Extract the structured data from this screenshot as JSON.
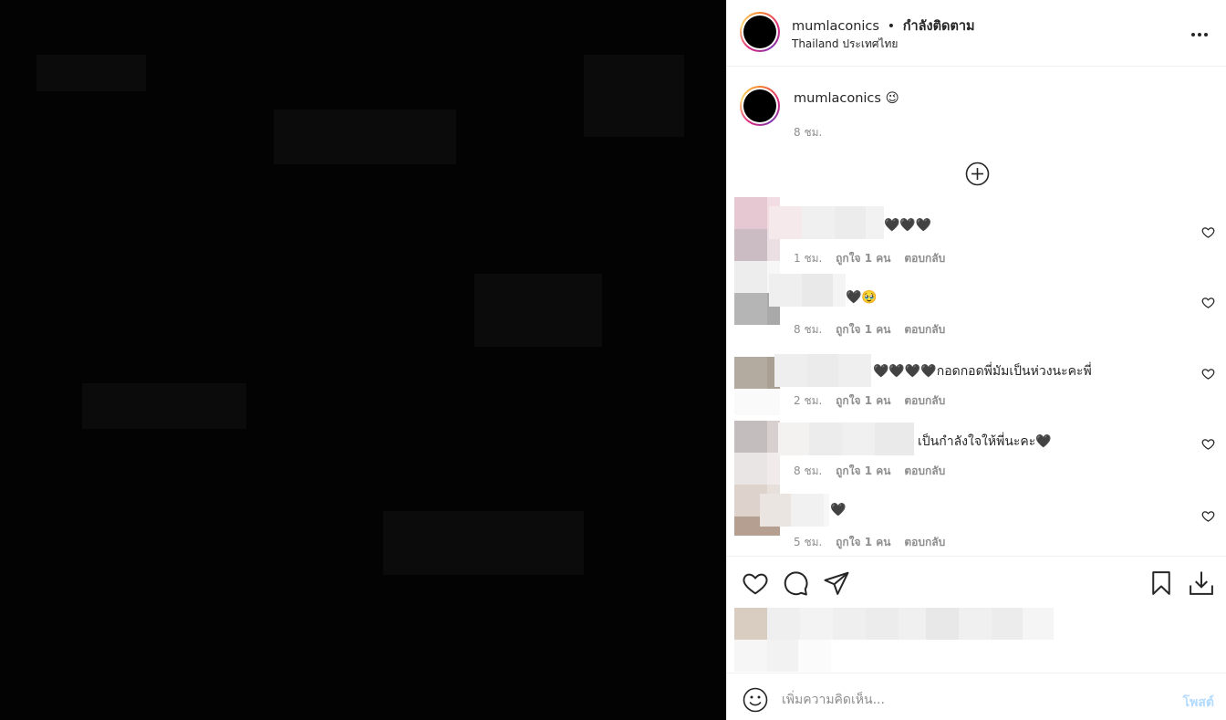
{
  "header": {
    "username": "mumlaconics",
    "separator": "•",
    "follow_status": "กำลังติดตาม",
    "location": "Thailand ประเทศไทย",
    "more_label": "•••"
  },
  "caption": {
    "username": "mumlaconics",
    "emoji": "😉",
    "time": "8 ชม."
  },
  "comments": [
    {
      "text": "🖤🖤🖤",
      "time": "1 ชม.",
      "likes": "ถูกใจ 1 คน",
      "reply": "ตอบกลับ"
    },
    {
      "text": "🖤🥹",
      "time": "8 ชม.",
      "likes": "ถูกใจ 1 คน",
      "reply": "ตอบกลับ"
    },
    {
      "text": "🖤🖤🖤🖤กอดกอดพี่มัมเป็นห่วงนะคะพี่",
      "time": "2 ชม.",
      "likes": "ถูกใจ 1 คน",
      "reply": "ตอบกลับ"
    },
    {
      "text": "เป็นกำลังใจให้พี่นะคะ🖤",
      "time": "8 ชม.",
      "likes": "ถูกใจ 1 คน",
      "reply": "ตอบกลับ"
    },
    {
      "text": "🖤",
      "time": "5 ชม.",
      "likes": "ถูกใจ 1 คน",
      "reply": "ตอบกลับ"
    }
  ],
  "comment_box": {
    "placeholder": "เพิ่มความคิดเห็น...",
    "post_label": "โพสต์"
  },
  "colors": {
    "post_button_disabled": "#b3dbff",
    "muted_text": "#8e8e8e",
    "divider": "#efefef"
  },
  "icons": [
    "more-options-icon",
    "add-circle-icon",
    "heart-icon",
    "comment-icon",
    "share-icon",
    "bookmark-icon",
    "download-icon",
    "emoji-icon"
  ]
}
